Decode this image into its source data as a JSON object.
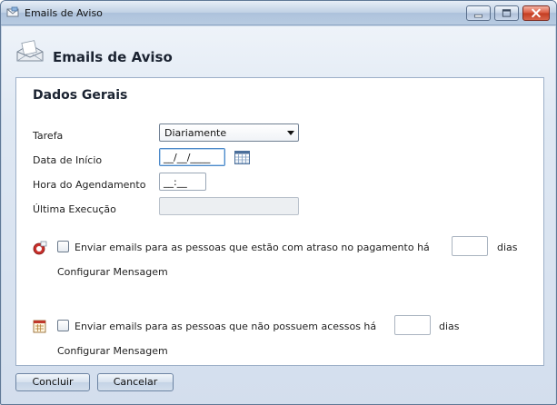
{
  "window": {
    "title": "Emails de Aviso",
    "controls": {
      "minimize": "minimize-icon",
      "maximize": "maximize-icon",
      "close": "close-icon"
    }
  },
  "header": {
    "title": "Emails de Aviso",
    "icon": "email-icon"
  },
  "section": {
    "title": "Dados Gerais"
  },
  "form": {
    "tarefa_label": "Tarefa",
    "tarefa_value": "Diariamente",
    "data_inicio_label": "Data de Início",
    "data_inicio_value": "__/__/____",
    "hora_label": "Hora do Agendamento",
    "hora_value": "__:__",
    "ultima_label": "Última Execução",
    "ultima_value": ""
  },
  "options": [
    {
      "icon": "late-payment-icon",
      "label": "Enviar emails para as pessoas que estão com atraso no pagamento há",
      "days_value": "",
      "days_label": "dias",
      "link": "Configurar Mensagem",
      "checked": false
    },
    {
      "icon": "calendar-icon",
      "label": "Enviar emails para as pessoas que não possuem acessos há",
      "days_value": "",
      "days_label": "dias",
      "link": "Configurar Mensagem",
      "checked": false
    }
  ],
  "footer": {
    "concluir": "Concluir",
    "cancelar": "Cancelar"
  }
}
